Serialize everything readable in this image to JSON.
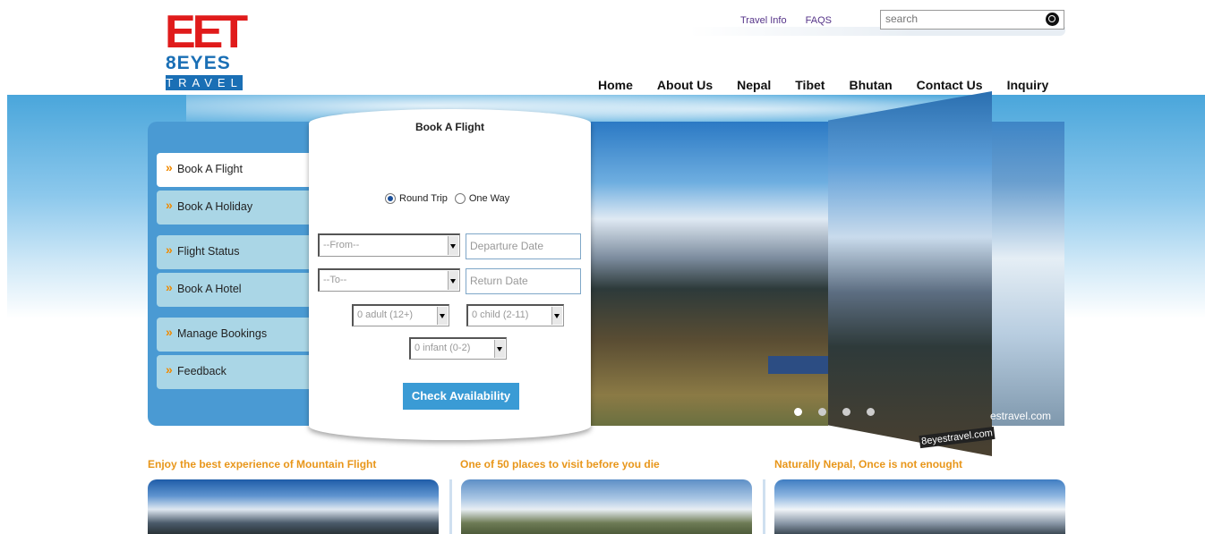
{
  "brand": {
    "logo_main": "EET",
    "logo_sub": "8EYES",
    "logo_travel": "TRAVEL"
  },
  "top_links": [
    "Travel Info",
    "FAQS"
  ],
  "search": {
    "placeholder": "search"
  },
  "nav": [
    "Home",
    "About Us",
    "Nepal",
    "Tibet",
    "Bhutan",
    "Contact Us",
    "Inquiry"
  ],
  "side_menu": [
    {
      "label": "Book A Flight",
      "active": true
    },
    {
      "label": "Book A Holiday",
      "active": false
    },
    {
      "label": "Flight Status",
      "active": false
    },
    {
      "label": "Book A Hotel",
      "active": false
    },
    {
      "label": "Manage Bookings",
      "active": false
    },
    {
      "label": "Feedback",
      "active": false
    }
  ],
  "booking": {
    "title": "Book A Flight",
    "trip_round": "Round Trip",
    "trip_one": "One Way",
    "from": "--From--",
    "to": "--To--",
    "departure_placeholder": "Departure Date",
    "return_placeholder": "Return Date",
    "adults": "0 adult (12+)",
    "children": "0 child (2-11)",
    "infants": "0 infant (0-2)",
    "submit": "Check Availability"
  },
  "slider": {
    "watermark_fold": "8eyestravel.com",
    "watermark_right": "estravel.com",
    "dots": 4,
    "active_dot": 0
  },
  "features": [
    {
      "title": "Enjoy the best experience of Mountain Flight"
    },
    {
      "title": "One of 50 places to visit before you die"
    },
    {
      "title": "Naturally Nepal, Once is not enought"
    }
  ],
  "colors": {
    "accent": "#3a9bd5",
    "panel": "#4a9ad3",
    "logo_red": "#e01b1b",
    "logo_blue": "#1a6fb5",
    "feature_title": "#e8961a"
  }
}
